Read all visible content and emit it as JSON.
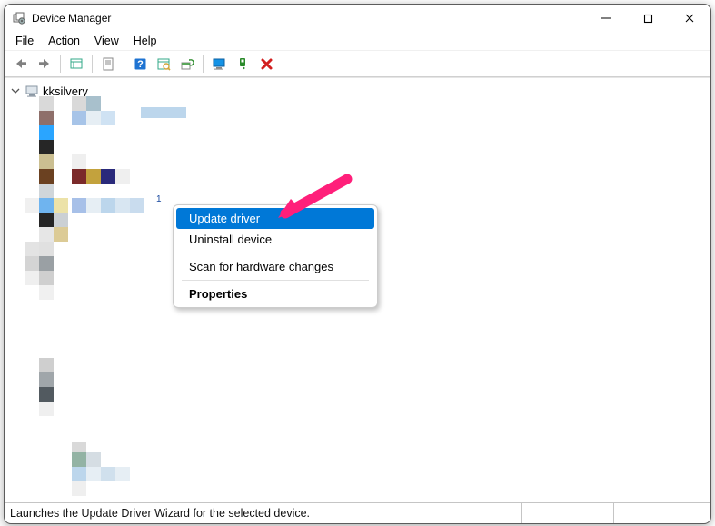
{
  "window": {
    "title": "Device Manager"
  },
  "menubar": [
    "File",
    "Action",
    "View",
    "Help"
  ],
  "toolbar_icons": [
    "back-arrow-icon",
    "forward-arrow-icon",
    "|",
    "show-hidden-icon",
    "|",
    "properties-sheet-icon",
    "|",
    "help-icon",
    "scan-hardware-icon",
    "update-driver-icon",
    "|",
    "monitor-icon",
    "enable-device-icon",
    "delete-icon"
  ],
  "tree": {
    "root_label": "kksilvery",
    "selected_marker": "1"
  },
  "context_menu": {
    "items": [
      {
        "label": "Update driver",
        "highlight": true
      },
      {
        "label": "Uninstall device"
      },
      {
        "sep": true
      },
      {
        "label": "Scan for hardware changes"
      },
      {
        "sep": true
      },
      {
        "label": "Properties",
        "bold": true
      }
    ]
  },
  "statusbar": {
    "text": "Launches the Update Driver Wizard for the selected device."
  },
  "colors": {
    "highlight": "#0078d7"
  }
}
